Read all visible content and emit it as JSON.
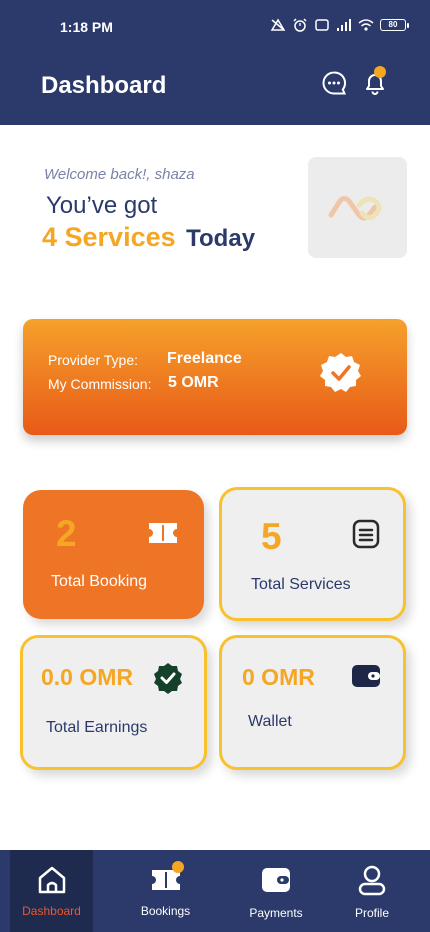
{
  "status_bar": {
    "time": "1:18 PM",
    "battery": "80"
  },
  "header": {
    "title": "Dashboard"
  },
  "greeting": {
    "welcome": "Welcome back!, shaza",
    "got": "You’ve got",
    "services_count_text": "4 Services",
    "today": "Today"
  },
  "provider_card": {
    "type_label": "Provider Type:",
    "type_value": "Freelance",
    "commission_label": "My Commission:",
    "commission_value": "5 OMR"
  },
  "stats": {
    "total_booking": {
      "value": "2",
      "label": "Total Booking"
    },
    "total_services": {
      "value": "5",
      "label": "Total Services"
    },
    "total_earnings": {
      "value": "0.0 OMR",
      "label": "Total Earnings"
    },
    "wallet": {
      "value": "0 OMR",
      "label": "Wallet"
    }
  },
  "nav": {
    "items": [
      {
        "label": "Dashboard",
        "icon": "home-icon",
        "active": true
      },
      {
        "label": "Bookings",
        "icon": "ticket-icon",
        "active": false
      },
      {
        "label": "Payments",
        "icon": "wallet-icon",
        "active": false
      },
      {
        "label": "Profile",
        "icon": "user-icon",
        "active": false
      }
    ]
  },
  "colors": {
    "navy": "#2b3a6b",
    "accent_yellow": "#f5a623",
    "orange": "#ee7526",
    "active_nav_label": "#f0562a"
  }
}
